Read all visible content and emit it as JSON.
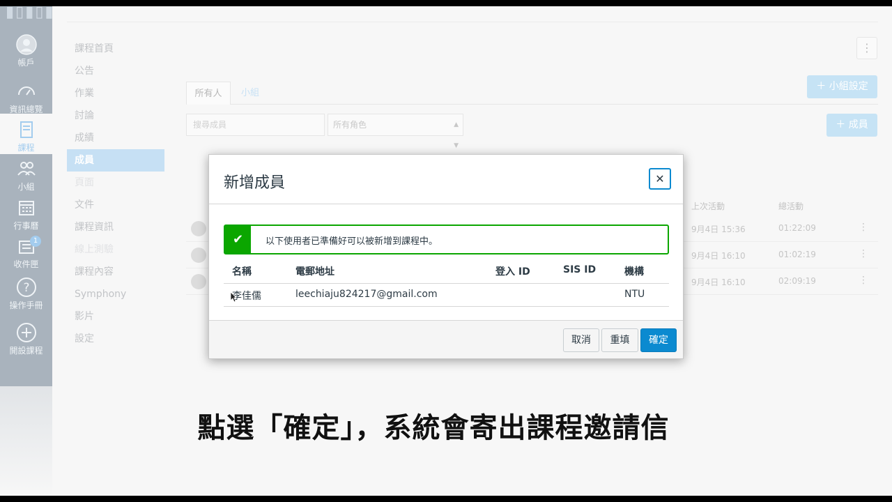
{
  "global_nav": {
    "items": [
      {
        "label": "帳戶",
        "icon": "user-icon"
      },
      {
        "label": "資訊總覽",
        "icon": "dashboard-icon"
      },
      {
        "label": "課程",
        "icon": "book-icon"
      },
      {
        "label": "小組",
        "icon": "group-icon"
      },
      {
        "label": "行事曆",
        "icon": "calendar-icon"
      },
      {
        "label": "收件匣",
        "icon": "inbox-icon",
        "badge": "1"
      },
      {
        "label": "操作手冊",
        "icon": "help-icon"
      },
      {
        "label": "開設課程",
        "icon": "plus-circle-icon"
      }
    ]
  },
  "course_nav": {
    "items": [
      "課程首頁",
      "公告",
      "作業",
      "討論",
      "成績",
      "成員",
      "頁面",
      "文件",
      "課程資訊",
      "線上測驗",
      "課程內容",
      "Symphony",
      "影片",
      "設定"
    ],
    "active_index": 5
  },
  "people": {
    "tabs": [
      "所有人",
      "小組"
    ],
    "group_settings_button": "小組設定",
    "search_placeholder": "搜尋成員",
    "role_select": "所有角色",
    "add_member_button": "成員",
    "columns": [
      "上次活動",
      "總活動"
    ],
    "rows": [
      {
        "last_activity": "9月4日 15:36",
        "total_activity": "01:22:09"
      },
      {
        "last_activity": "9月4日 16:10",
        "total_activity": "01:02:19"
      },
      {
        "last_activity": "9月4日 16:10",
        "total_activity": "02:09:19"
      }
    ]
  },
  "modal": {
    "title": "新增成員",
    "alert_text": "以下使用者已準備好可以被新增到課程中。",
    "headers": [
      "名稱",
      "電郵地址",
      "登入 ID",
      "SIS ID",
      "機構"
    ],
    "user": {
      "name": "李佳儒",
      "email": "leechiaju824217@gmail.com",
      "login_id": "",
      "sis_id": "",
      "institution": "NTU"
    },
    "buttons": {
      "cancel": "取消",
      "reset": "重填",
      "confirm": "確定"
    }
  },
  "caption": "點選「確定」，系統會寄出課程邀請信",
  "colors": {
    "brand_blue": "#0b8ad0",
    "success_green": "#0ba600",
    "nav_bg": "#a9b3bd"
  }
}
